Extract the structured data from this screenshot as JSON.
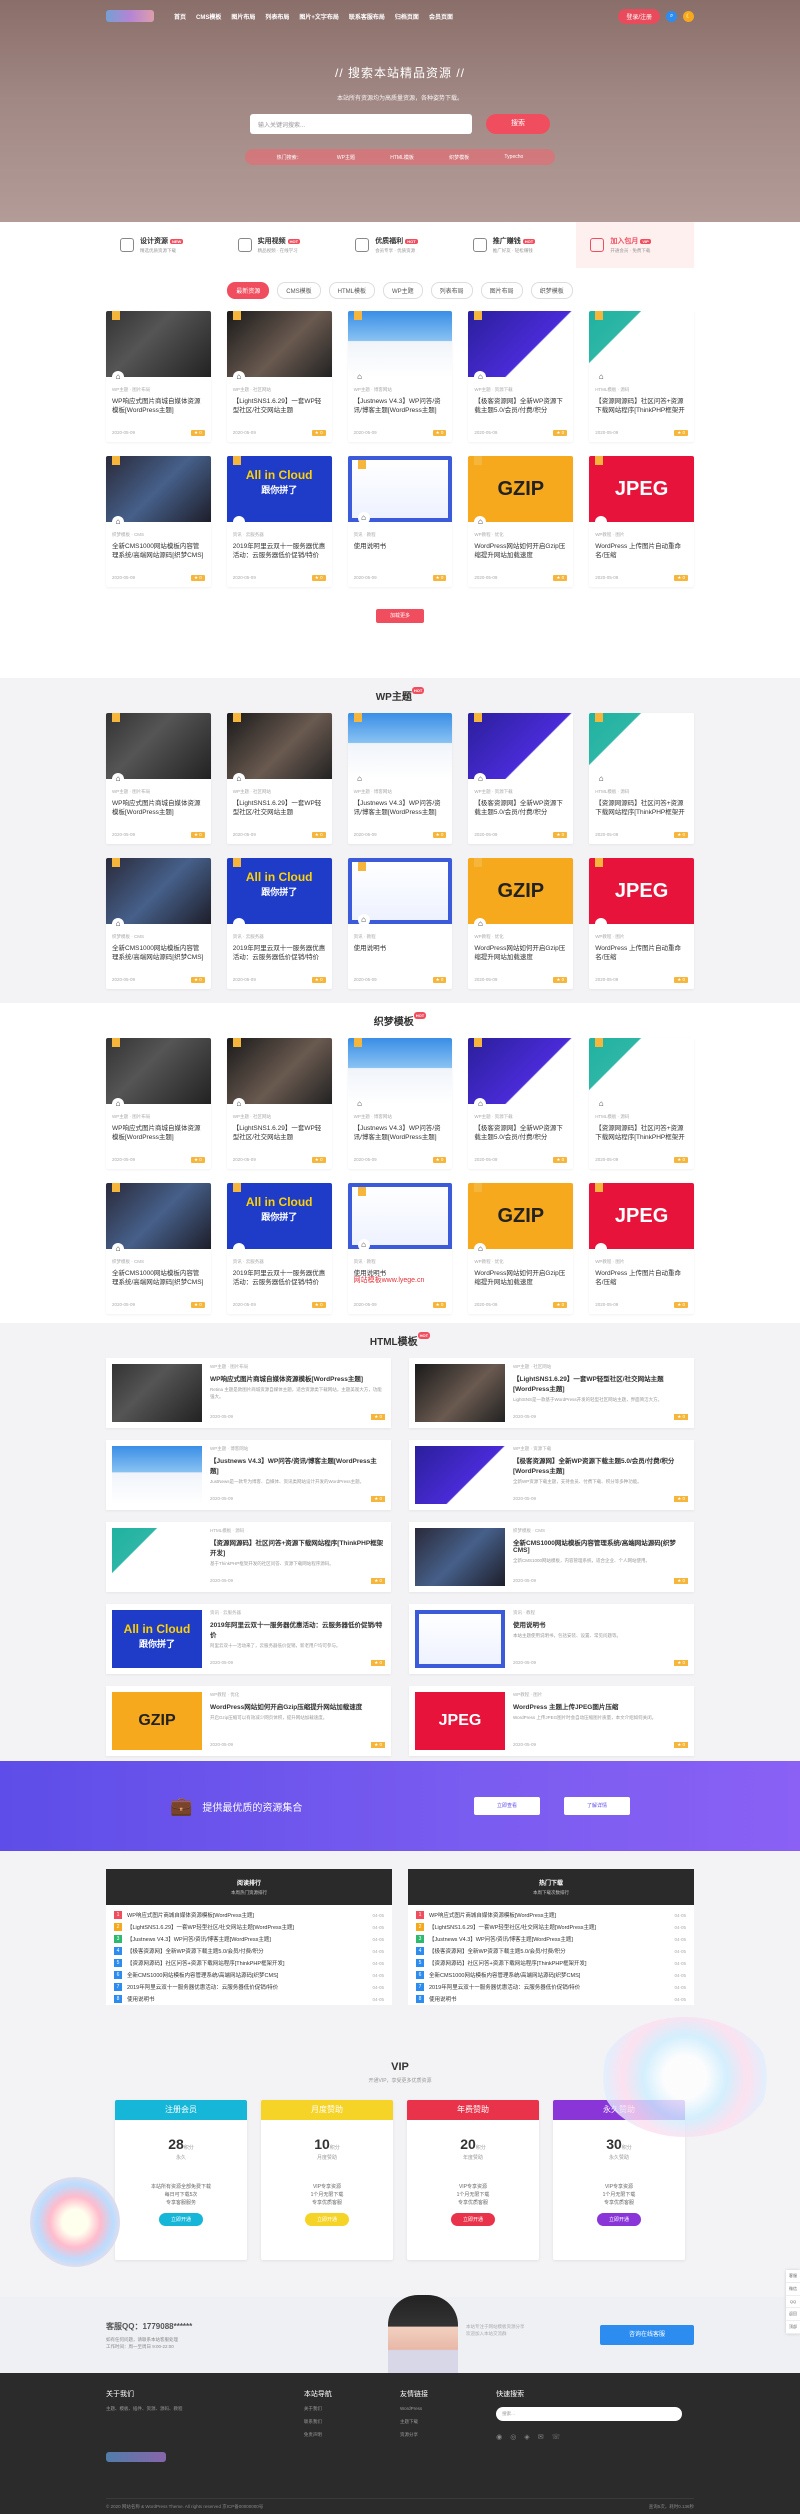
{
  "nav": {
    "items": [
      "首页",
      "CMS模板",
      "图片布局",
      "列表布局",
      "图片+文字布局",
      "联系客服布局",
      "归档页面",
      "会员页面"
    ],
    "login": "登录/注册"
  },
  "hero": {
    "title": "// 搜索本站精品资源 //",
    "subtitle": "本站所有资源均为高质量资源，各种姿势下载。",
    "search_placeholder": "输入关键词搜索...",
    "search_button": "搜索",
    "hot_words": [
      "热门搜索：",
      "WP主题",
      "HTML模板",
      "织梦模板",
      "Typecho"
    ]
  },
  "features": [
    {
      "title": "设计资源",
      "tag": "NEW",
      "desc": "精选优质资源下载"
    },
    {
      "title": "实用视频",
      "tag": "HOT",
      "desc": "精品视频 · 在线学习"
    },
    {
      "title": "优质福利",
      "tag": "HOT",
      "desc": "会员专享 · 优质资源"
    },
    {
      "title": "推广赚钱",
      "tag": "HOT",
      "desc": "推广好友 · 轻松赚钱"
    },
    {
      "title": "加入包月",
      "tag": "VIP",
      "desc": "开通会员 · 免费下载"
    }
  ],
  "tabs": [
    "最新资源",
    "CMS模板",
    "HTML模板",
    "WP主题",
    "列表布局",
    "图片布局",
    "织梦模板"
  ],
  "cards": [
    {
      "title": "WP响应式图片商城自媒体资源模板[WordPress主题]",
      "meta": "WP主题 · 图片布局",
      "date": "2020-05-09",
      "thumb": "dark"
    },
    {
      "title": "【LightSNS1.6.29】一套WP轻型社区/社交网站主题[WordPress主题]",
      "meta": "WP主题 · 社区网站",
      "date": "2020-05-09",
      "thumb": "dark2"
    },
    {
      "title": "【Justnews V4.3】WP问答/资讯/博客主题[WordPress主题]",
      "meta": "WP主题 · 博客网站",
      "date": "2020-05-09",
      "thumb": "blue"
    },
    {
      "title": "【极客资源网】全新WP资源下载主题5.0/会员/付费/积分[WordPress主题]",
      "meta": "WP主题 · 资源下载",
      "date": "2020-05-09",
      "thumb": "purple"
    },
    {
      "title": "【资源网源码】社区问答+资源下载网站程序[ThinkPHP框架开发]",
      "meta": "HTML模板 · 源码",
      "date": "2020-05-09",
      "thumb": "green"
    },
    {
      "title": "全新CMS1000网站模板内容管理系统/高端网站源码[织梦CMS]",
      "meta": "织梦模板 · CMS",
      "date": "2020-05-09",
      "thumb": "navy"
    },
    {
      "title": "2019年阿里云双十一服务器优惠活动：云服务器低价促销/特价",
      "meta": "资讯 · 云服务器",
      "date": "2020-05-09",
      "thumb": "aic"
    },
    {
      "title": "使用说明书",
      "meta": "资讯 · 教程",
      "date": "2020-05-09",
      "thumb": "phone"
    },
    {
      "title": "WordPress网站如何开启Gzip压缩提升网站加载速度",
      "meta": "WP教程 · 优化",
      "date": "2020-05-09",
      "thumb": "gzip"
    },
    {
      "title": "WordPress 上传图片自动重命名/压缩",
      "meta": "WP教程 · 图片",
      "date": "2020-05-09",
      "thumb": "jpeg"
    }
  ],
  "more_button": "加载更多",
  "section_titles": {
    "wp": "WP主题",
    "dede": "织梦模板",
    "html": "HTML模板",
    "tag": "HOT"
  },
  "watermark_text": "网站模板www.lyege.cn",
  "list_items": [
    {
      "title": "WP响应式图片商城自媒体资源模板[WordPress主题]",
      "desc": "Retina 主题是款图片商城资源自媒体主题，适合资源类下载网站，主题美观大方，功能强大。",
      "date": "2020-05-09",
      "thumb": "dark"
    },
    {
      "title": "【LightSNS1.6.29】一套WP轻型社区/社交网站主题[WordPress主题]",
      "desc": "LightSNS是一款基于WordPress开发的轻型社区网站主题，界面简洁大方。",
      "date": "2020-05-09",
      "thumb": "dark2"
    },
    {
      "title": "【Justnews V4.3】WP问答/资讯/博客主题[WordPress主题]",
      "desc": "JustNews是一款专为博客、自媒体、资讯类网站设计开发的WordPress主题。",
      "date": "2020-05-09",
      "thumb": "blue"
    },
    {
      "title": "【极客资源网】全新WP资源下载主题5.0/会员/付费/积分[WordPress主题]",
      "desc": "全新WP资源下载主题，支持会员、付费下载、积分等多种功能。",
      "date": "2020-05-09",
      "thumb": "purple"
    },
    {
      "title": "【资源网源码】社区问答+资源下载网站程序[ThinkPHP框架开发]",
      "desc": "基于ThinkPHP框架开发的社区问答、资源下载网站程序源码。",
      "date": "2020-05-09",
      "thumb": "green"
    },
    {
      "title": "全新CMS1000网站模板内容管理系统/高端网站源码[织梦CMS]",
      "desc": "全新CMS1000网站模板，内容管理系统，适合企业、个人网站使用。",
      "date": "2020-05-09",
      "thumb": "navy"
    },
    {
      "title": "2019年阿里云双十一服务器优惠活动：云服务器低价促销/特价",
      "desc": "阿里云双十一活动来了，云服务器低价促销，新老用户均可参与。",
      "date": "2020-05-09",
      "thumb": "aic"
    },
    {
      "title": "使用说明书",
      "desc": "本站主题使用说明书，包括安装、设置、常见问题等。",
      "date": "2020-05-09",
      "thumb": "phone"
    },
    {
      "title": "WordPress网站如何开启Gzip压缩提升网站加载速度",
      "desc": "开启Gzip压缩可以有效减少网页体积，提升网站加载速度。",
      "date": "2020-05-09",
      "thumb": "gzip"
    },
    {
      "title": "WordPress 主题上传JPEG图片压缩",
      "desc": "WordPress 上传JPEG图片时会自动压缩图片质量，本文介绍如何关闭。",
      "date": "2020-05-09",
      "thumb": "jpeg"
    }
  ],
  "banner": {
    "title": "提供最优质的资源集合",
    "btn1": "立即查看",
    "btn2": "了解详情"
  },
  "rank_left": {
    "title": "阅读排行",
    "sub": "本周热门资源排行",
    "items": [
      "WP响应式图片商城自媒体资源模板[WordPress主题]",
      "【LightSNS1.6.29】一套WP轻型社区/社交网站主题[WordPress主题]",
      "【Justnews V4.3】WP问答/资讯/博客主题[WordPress主题]",
      "【极客资源网】全新WP资源下载主题5.0/会员/付费/积分",
      "【资源网源码】社区问答+资源下载网站程序[ThinkPHP框架开发]",
      "全新CMS1000网站模板内容管理系统/高端网站源码[织梦CMS]",
      "2019年阿里云双十一服务器优惠活动：云服务器低价促销/特价",
      "使用说明书"
    ]
  },
  "rank_right": {
    "title": "热门下载",
    "sub": "本周下载次数排行",
    "items": [
      "WP响应式图片商城自媒体资源模板[WordPress主题]",
      "【LightSNS1.6.29】一套WP轻型社区/社交网站主题[WordPress主题]",
      "【Justnews V4.3】WP问答/资讯/博客主题[WordPress主题]",
      "【极客资源网】全新WP资源下载主题5.0/会员/付费/积分",
      "【资源网源码】社区问答+资源下载网站程序[ThinkPHP框架开发]",
      "全新CMS1000网站模板内容管理系统/高端网站源码[织梦CMS]",
      "2019年阿里云双十一服务器优惠活动：云服务器低价促销/特价",
      "使用说明书"
    ]
  },
  "rank_date": "04-05",
  "vip": {
    "title": "VIP",
    "subtitle": "开通VIP，享受更多优质资源",
    "plans": [
      {
        "name": "注册会员",
        "price": "28",
        "unit": "积分",
        "period": "永久",
        "desc": "本站所有资源全部免费下载\n每日可下载5次\n专享客服服务",
        "btn": "立即开通",
        "color": "#16b6d8"
      },
      {
        "name": "月度赞助",
        "price": "10",
        "unit": "积分",
        "period": "月度赞助",
        "desc": "VIP专享资源\n1个月无限下载\n专享优质客服",
        "btn": "立即开通",
        "color": "#f5d327"
      },
      {
        "name": "年费赞助",
        "price": "20",
        "unit": "积分",
        "period": "年度赞助",
        "desc": "VIP专享资源\n1个月无限下载\n专享优质客服",
        "btn": "立即开通",
        "color": "#e8334a"
      },
      {
        "name": "永久赞助",
        "price": "30",
        "unit": "积分",
        "period": "永久赞助",
        "desc": "VIP专享资源\n1个月无限下载\n专享优质客服",
        "btn": "立即开通",
        "color": "#8a35d8"
      }
    ]
  },
  "contact": {
    "title": "客服QQ：1779088******",
    "desc": "如有任何问题，请联系本站客服处理\n工作时间：周一至周日 9:00-22:00",
    "mid": "本站专注于网站模板资源分享\n欢迎加入本站交流群",
    "button": "咨询在线客服"
  },
  "footer": {
    "about_title": "关于我们",
    "about_text": "主题、模板、插件、资源、源码、教程",
    "nav_title": "本站导航",
    "nav_items": [
      "关于我们",
      "联系我们",
      "免责声明"
    ],
    "link_title": "友情链接",
    "link_items": [
      "WordPress",
      "主题下载",
      "资源分享"
    ],
    "search_title": "快速搜索",
    "search_placeholder": "搜索...",
    "copyright": "© 2020 网站名称 & WordPress Theme. All rights reserved 京ICP备00000000号",
    "stats": "查询5次，耗时0.136秒"
  },
  "sidebar": [
    "客服",
    "微信",
    "QQ",
    "返回",
    "顶部"
  ]
}
